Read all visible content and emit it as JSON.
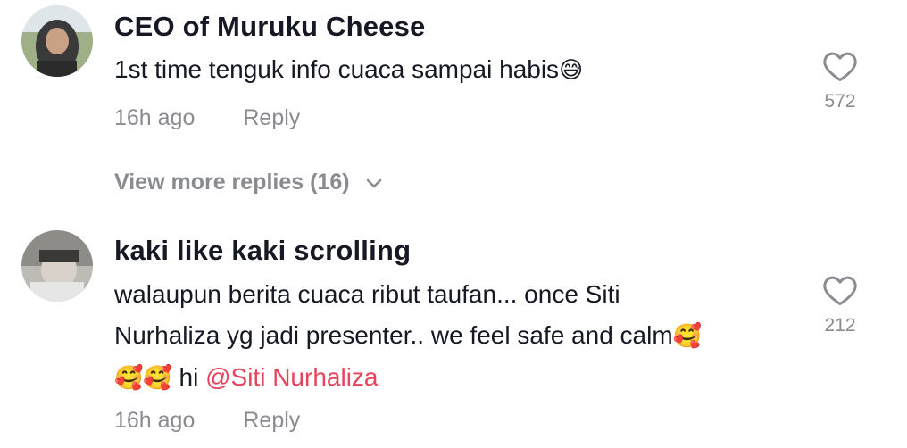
{
  "comments": [
    {
      "username": "CEO of Muruku Cheese",
      "text": "1st time tenguk info cuaca sampai habis",
      "emoji": "😅",
      "time": "16h ago",
      "reply_label": "Reply",
      "like_count": "572",
      "avatar_icon": "user-avatar-hijab"
    },
    {
      "username": "kaki like kaki scrolling",
      "text_line1": "walaupun berita cuaca ribut taufan... once Siti",
      "text_line2": "Nurhaliza yg jadi presenter.. we feel safe and calm",
      "emoji_inline": "🥰",
      "emoji_line3": "🥰🥰",
      "text_hi": " hi ",
      "mention": "@Siti Nurhaliza",
      "time": "16h ago",
      "reply_label": "Reply",
      "like_count": "212",
      "avatar_icon": "user-avatar-photo"
    }
  ],
  "view_more": {
    "label": "View more replies (16)",
    "icon": "chevron-down-icon"
  },
  "colors": {
    "text": "#161823",
    "secondary": "#8a8b91",
    "mention": "#E8435D"
  }
}
